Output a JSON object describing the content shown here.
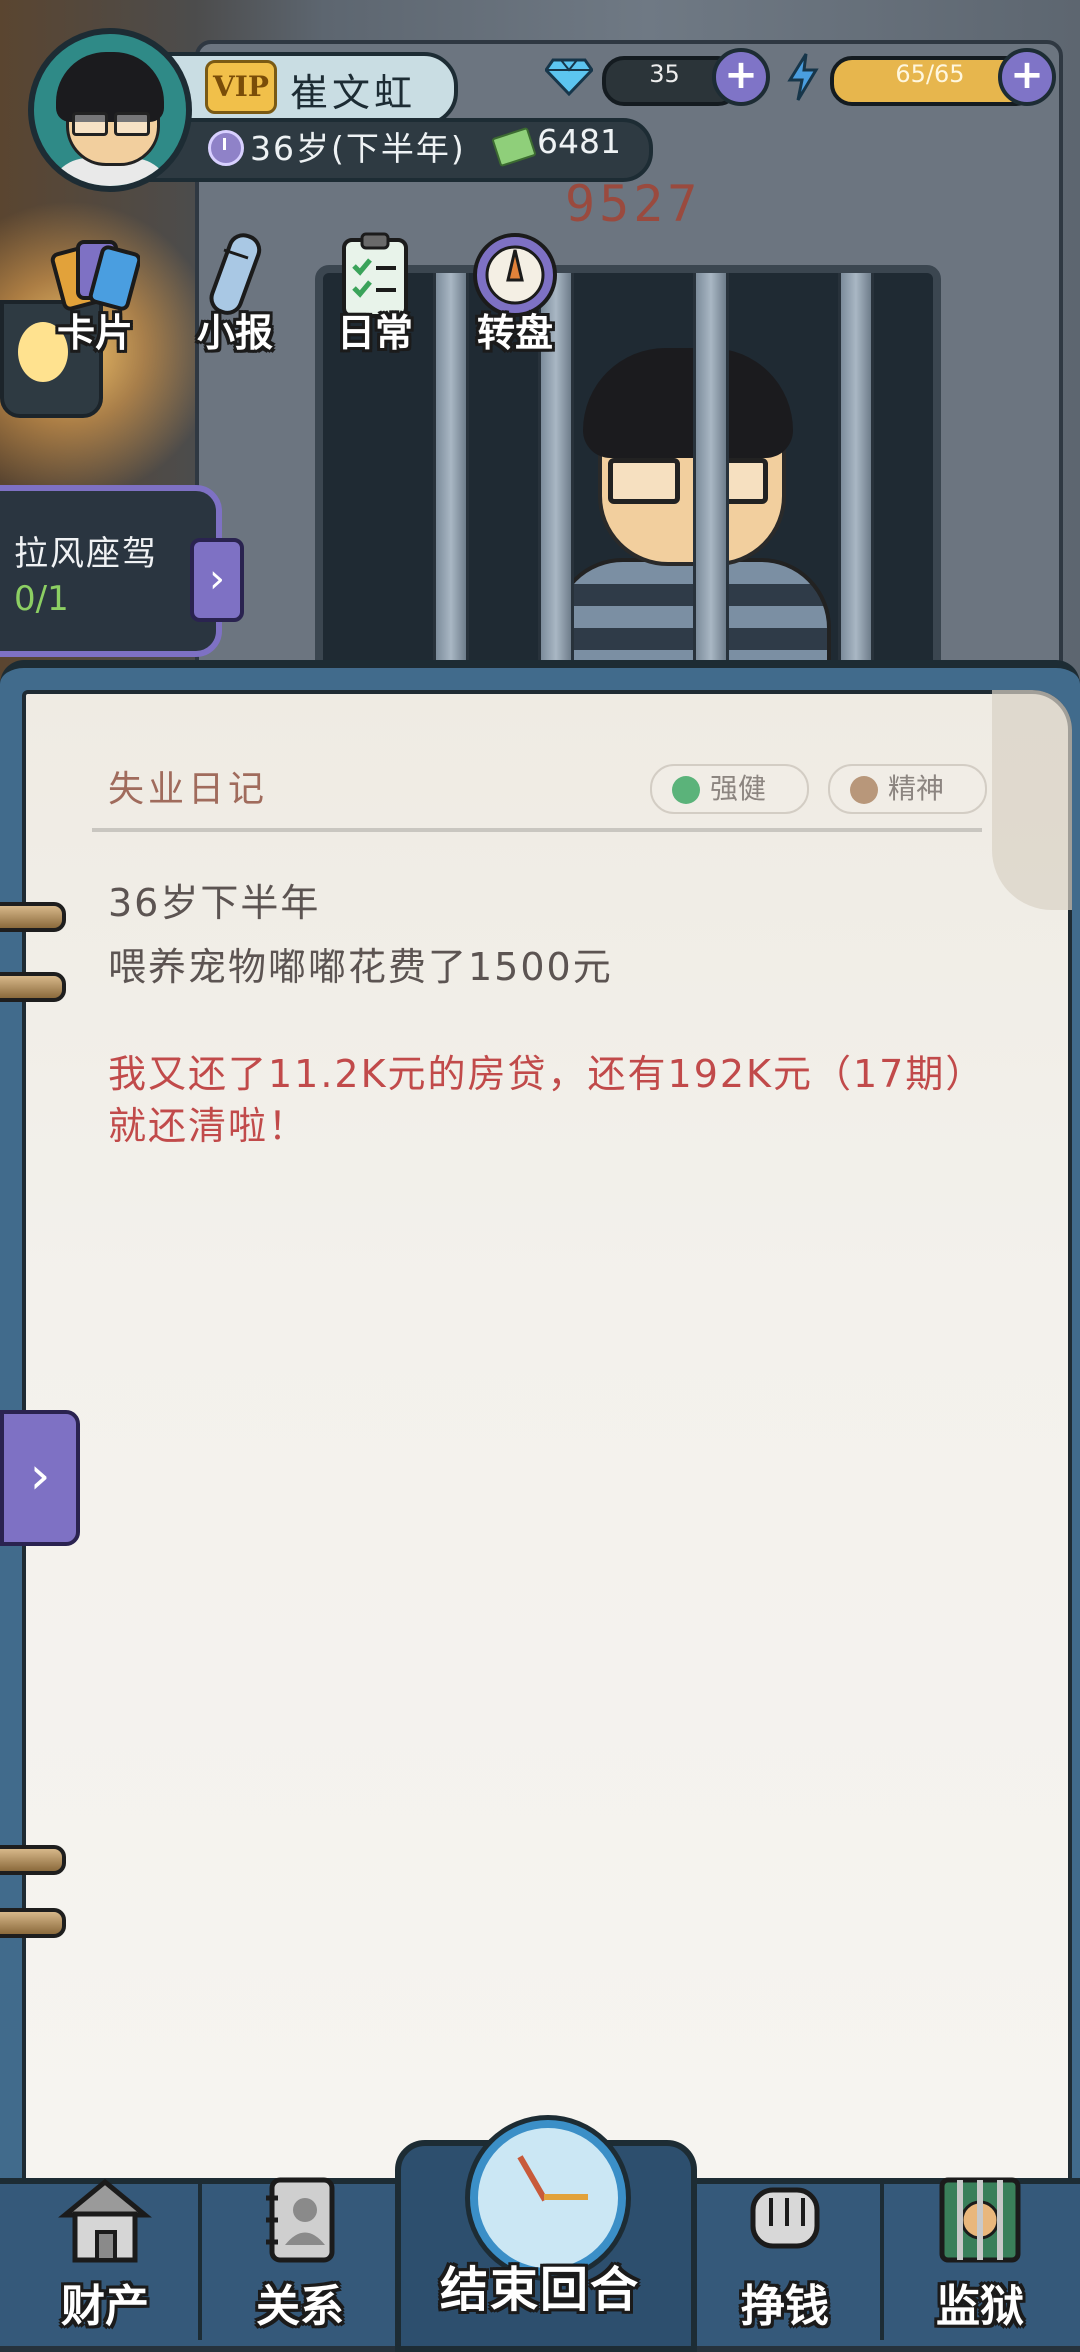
{
  "player": {
    "vip_label": "VIP",
    "name": "崔文虹",
    "age": "36岁(下半年)",
    "money": "6481"
  },
  "resources": {
    "gems": "35",
    "energy": "65/65",
    "gem_icon": "diamond-icon",
    "energy_icon": "lightning-icon"
  },
  "features": [
    {
      "label": "卡片",
      "icon": "cards-icon"
    },
    {
      "label": "小报",
      "icon": "newspaper-icon"
    },
    {
      "label": "日常",
      "icon": "clipboard-icon"
    },
    {
      "label": "转盘",
      "icon": "wheel-icon"
    }
  ],
  "scene": {
    "cell_number": "9527"
  },
  "quest": {
    "title": "拉风座驾",
    "progress": "0/1"
  },
  "diary": {
    "title": "失业日记",
    "tags": [
      {
        "label": "强健",
        "icon": "heartbeat-icon",
        "color": "#5bb37a"
      },
      {
        "label": "精神",
        "icon": "heart-icon",
        "color": "#b8977a"
      }
    ],
    "entries": [
      "36岁下半年",
      "喂养宠物嘟嘟花费了1500元"
    ],
    "highlight": "我又还了11.2K元的房贷，还有192K元（17期）就还清啦！"
  },
  "nav": [
    {
      "label": "财产",
      "icon": "house-icon"
    },
    {
      "label": "关系",
      "icon": "contacts-icon"
    },
    {
      "label": "结束回合",
      "icon": "alarm-clock-icon"
    },
    {
      "label": "挣钱",
      "icon": "money-fist-icon"
    },
    {
      "label": "监狱",
      "icon": "prison-icon"
    }
  ],
  "colors": {
    "accent": "#7e71c4",
    "diary_red": "#c14a4a",
    "notebook_blue": "#416b8c"
  }
}
